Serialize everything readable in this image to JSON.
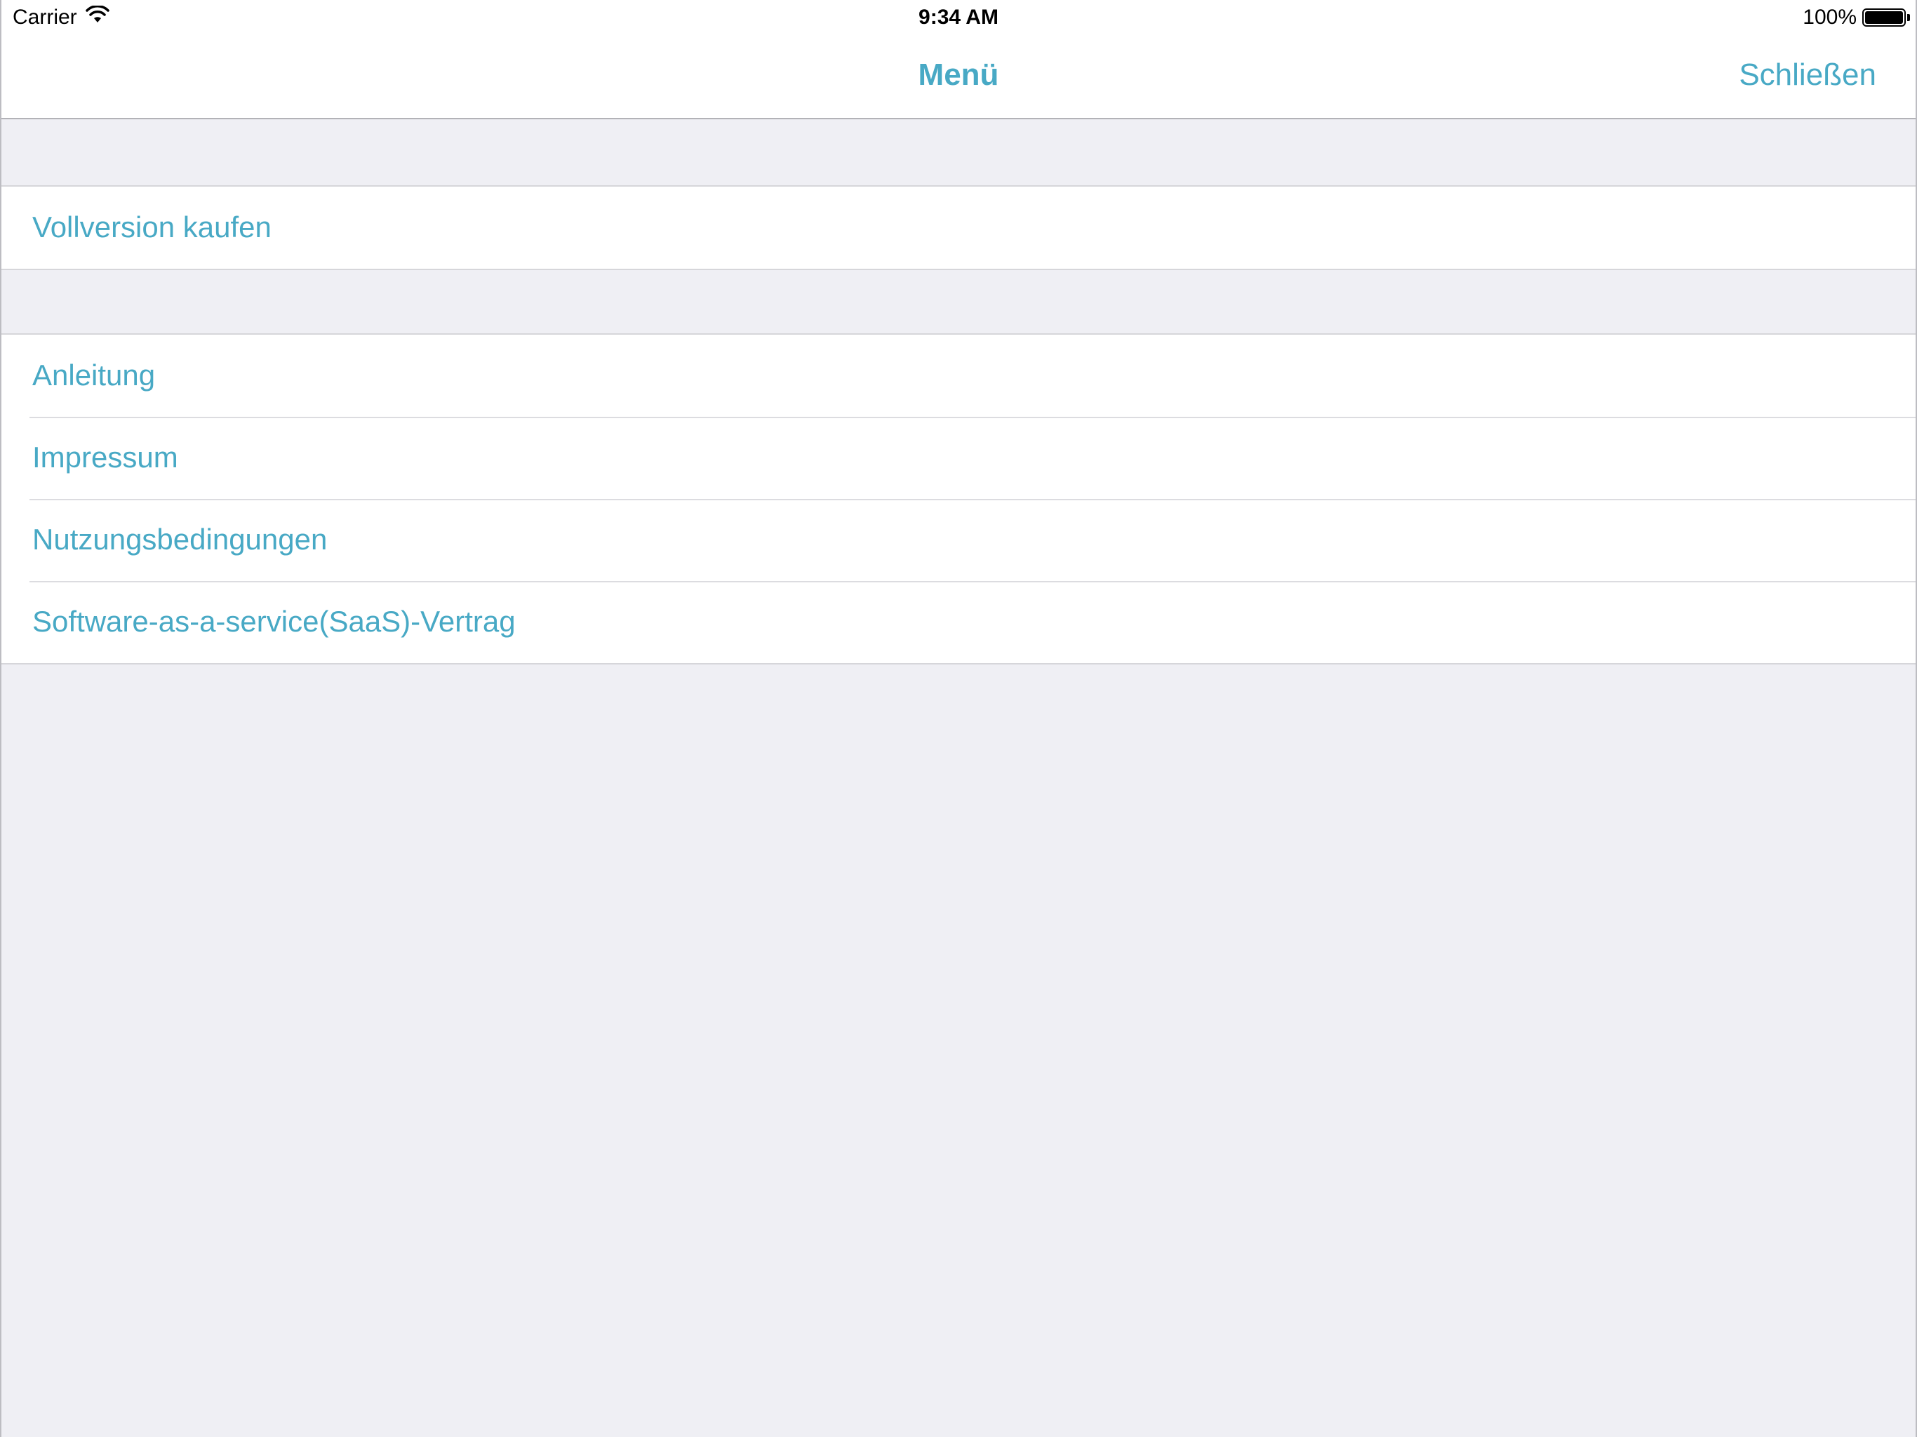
{
  "status_bar": {
    "carrier": "Carrier",
    "time": "9:34 AM",
    "battery_percent": "100%",
    "battery_level": 1.0
  },
  "nav": {
    "title": "Menü",
    "close_label": "Schließen"
  },
  "menu": {
    "purchase_items": [
      {
        "label": "Vollversion kaufen"
      }
    ],
    "info_items": [
      {
        "label": "Anleitung"
      },
      {
        "label": "Impressum"
      },
      {
        "label": "Nutzungsbedingungen"
      },
      {
        "label": "Software-as-a-service(SaaS)-Vertrag"
      }
    ]
  },
  "colors": {
    "accent": "#48a9c5",
    "background": "#efeff4"
  }
}
